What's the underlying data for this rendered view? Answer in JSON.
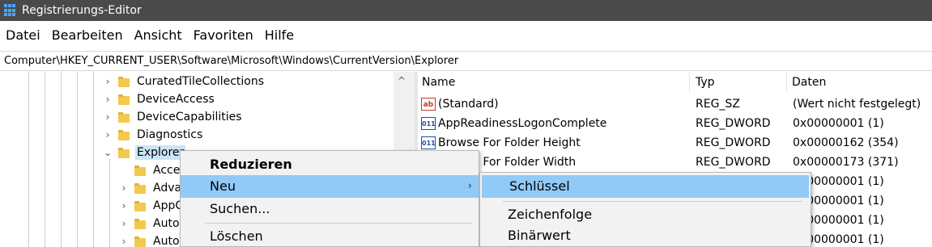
{
  "window": {
    "title": "Registrierungs-Editor"
  },
  "menubar": {
    "items": [
      "Datei",
      "Bearbeiten",
      "Ansicht",
      "Favoriten",
      "Hilfe"
    ]
  },
  "address": {
    "path": "Computer\\HKEY_CURRENT_USER\\Software\\Microsoft\\Windows\\CurrentVersion\\Explorer"
  },
  "tree": {
    "items": [
      {
        "label": "CuratedTileCollections",
        "expanded": false
      },
      {
        "label": "DeviceAccess",
        "expanded": false
      },
      {
        "label": "DeviceCapabilities",
        "expanded": false
      },
      {
        "label": "Diagnostics",
        "expanded": false
      },
      {
        "label": "Explorer",
        "expanded": true,
        "selected": true
      },
      {
        "label": "Acce",
        "expanded": false
      },
      {
        "label": "Adva",
        "expanded": false
      },
      {
        "label": "AppC",
        "expanded": false
      },
      {
        "label": "Auto",
        "expanded": false
      },
      {
        "label": "Auto",
        "expanded": false
      }
    ]
  },
  "values_pane": {
    "headers": {
      "name": "Name",
      "type": "Typ",
      "data": "Daten"
    },
    "rows": [
      {
        "icon": "ab",
        "name": "(Standard)",
        "type": "REG_SZ",
        "data": "(Wert nicht festgelegt)"
      },
      {
        "icon": "011",
        "name": "AppReadinessLogonComplete",
        "type": "REG_DWORD",
        "data": "0x00000001 (1)"
      },
      {
        "icon": "011",
        "name": "Browse For Folder Height",
        "type": "REG_DWORD",
        "data": "0x00000162 (354)"
      },
      {
        "icon": "011",
        "name": "Browse For Folder Width",
        "type": "REG_DWORD",
        "data": "0x00000173 (371)"
      },
      {
        "icon": "",
        "name": "",
        "type": "",
        "data": "0x00000001 (1)"
      },
      {
        "icon": "",
        "name": "",
        "type": "",
        "data": "0x00000001 (1)"
      },
      {
        "icon": "",
        "name": "",
        "type": "",
        "data": "0x00000001 (1)"
      },
      {
        "icon": "",
        "name": "",
        "type": "",
        "data": "0x00000001 (1)"
      }
    ]
  },
  "context_menu": {
    "collapse": "Reduzieren",
    "new": "Neu",
    "find": "Suchen...",
    "delete": "Löschen",
    "submenu_arrow": "›"
  },
  "submenu": {
    "key": "Schlüssel",
    "string": "Zeichenfolge",
    "binary": "Binärwert"
  },
  "colors": {
    "titlebar": "#4a4a4a",
    "highlight": "#91c9f7",
    "selection": "#cce4f7"
  },
  "icons": {
    "chevron_right": "›",
    "chevron_down": "⌄",
    "scroll_up": "^"
  }
}
